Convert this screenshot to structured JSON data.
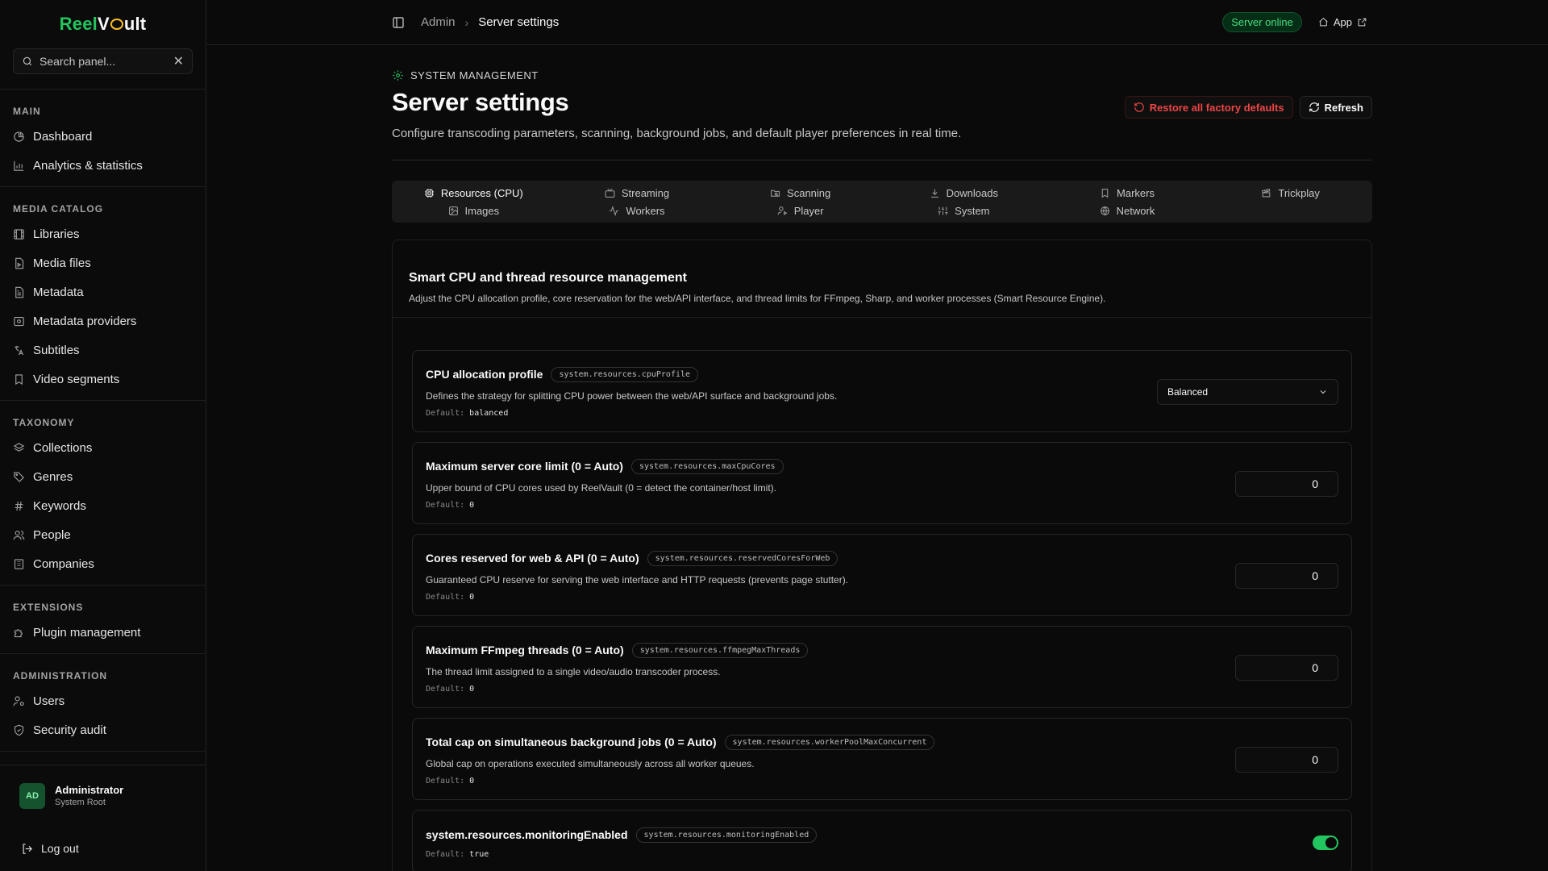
{
  "logo": {
    "part1": "Reel",
    "part2": "V",
    "part3": "ult"
  },
  "search": {
    "placeholder": "Search panel..."
  },
  "sidebar": {
    "sections": [
      {
        "title": "MAIN",
        "items": [
          {
            "label": "Dashboard",
            "icon": "pie-chart-icon"
          },
          {
            "label": "Analytics & statistics",
            "icon": "bar-chart-icon"
          }
        ]
      },
      {
        "title": "MEDIA CATALOG",
        "items": [
          {
            "label": "Libraries",
            "icon": "film-icon"
          },
          {
            "label": "Media files",
            "icon": "file-video-icon"
          },
          {
            "label": "Metadata",
            "icon": "file-text-icon"
          },
          {
            "label": "Metadata providers",
            "icon": "database-icon"
          },
          {
            "label": "Subtitles",
            "icon": "languages-icon"
          },
          {
            "label": "Video segments",
            "icon": "bookmark-icon"
          }
        ]
      },
      {
        "title": "TAXONOMY",
        "items": [
          {
            "label": "Collections",
            "icon": "layers-icon"
          },
          {
            "label": "Genres",
            "icon": "tag-icon"
          },
          {
            "label": "Keywords",
            "icon": "hash-icon"
          },
          {
            "label": "People",
            "icon": "users-icon"
          },
          {
            "label": "Companies",
            "icon": "building-icon"
          }
        ]
      },
      {
        "title": "EXTENSIONS",
        "items": [
          {
            "label": "Plugin management",
            "icon": "puzzle-icon"
          }
        ]
      },
      {
        "title": "ADMINISTRATION",
        "items": [
          {
            "label": "Users",
            "icon": "user-cog-icon"
          },
          {
            "label": "Security audit",
            "icon": "shield-icon"
          }
        ]
      }
    ]
  },
  "user": {
    "initials": "AD",
    "name": "Administrator",
    "role": "System Root"
  },
  "logout": {
    "label": "Log out"
  },
  "topbar": {
    "crumb1": "Admin",
    "crumb2": "Server settings",
    "status": "Server online",
    "app_link": "App"
  },
  "header": {
    "eyebrow": "SYSTEM MANAGEMENT",
    "title": "Server settings",
    "subtitle": "Configure transcoding parameters, scanning, background jobs, and default player preferences in real time.",
    "restore_label": "Restore all factory defaults",
    "refresh_label": "Refresh"
  },
  "tabs": [
    {
      "label": "Resources (CPU)",
      "icon": "cpu-icon",
      "active": true
    },
    {
      "label": "Streaming",
      "icon": "tv-icon",
      "active": false
    },
    {
      "label": "Scanning",
      "icon": "folder-search-icon",
      "active": false
    },
    {
      "label": "Downloads",
      "icon": "download-icon",
      "active": false
    },
    {
      "label": "Markers",
      "icon": "bookmark-icon",
      "active": false
    },
    {
      "label": "Trickplay",
      "icon": "clapperboard-icon",
      "active": false
    },
    {
      "label": "Images",
      "icon": "image-icon",
      "active": false
    },
    {
      "label": "Workers",
      "icon": "activity-icon",
      "active": false
    },
    {
      "label": "Player",
      "icon": "user-play-icon",
      "active": false
    },
    {
      "label": "System",
      "icon": "sliders-icon",
      "active": false
    },
    {
      "label": "Network",
      "icon": "globe-icon",
      "active": false
    }
  ],
  "panel": {
    "title": "Smart CPU and thread resource management",
    "desc": "Adjust the CPU allocation profile, core reservation for the web/API interface, and thread limits for FFmpeg, Sharp, and worker processes (Smart Resource Engine)."
  },
  "default_label": "Default:",
  "settings": [
    {
      "title": "CPU allocation profile",
      "key": "system.resources.cpuProfile",
      "desc": "Defines the strategy for splitting CPU power between the web/API surface and background jobs.",
      "default": "balanced",
      "control": "select",
      "value": "Balanced"
    },
    {
      "title": "Maximum server core limit (0 = Auto)",
      "key": "system.resources.maxCpuCores",
      "desc": "Upper bound of CPU cores used by ReelVault (0 = detect the container/host limit).",
      "default": "0",
      "control": "number",
      "value": "0"
    },
    {
      "title": "Cores reserved for web & API (0 = Auto)",
      "key": "system.resources.reservedCoresForWeb",
      "desc": "Guaranteed CPU reserve for serving the web interface and HTTP requests (prevents page stutter).",
      "default": "0",
      "control": "number",
      "value": "0"
    },
    {
      "title": "Maximum FFmpeg threads (0 = Auto)",
      "key": "system.resources.ffmpegMaxThreads",
      "desc": "The thread limit assigned to a single video/audio transcoder process.",
      "default": "0",
      "control": "number",
      "value": "0"
    },
    {
      "title": "Total cap on simultaneous background jobs (0 = Auto)",
      "key": "system.resources.workerPoolMaxConcurrent",
      "desc": "Global cap on operations executed simultaneously across all worker queues.",
      "default": "0",
      "control": "number",
      "value": "0"
    },
    {
      "title": "system.resources.monitoringEnabled",
      "key": "system.resources.monitoringEnabled",
      "desc": "",
      "default": "true",
      "control": "toggle",
      "value": "true"
    }
  ],
  "colors": {
    "accent": "#22c55e",
    "danger": "#ef4444",
    "background": "#0a0a0a"
  }
}
